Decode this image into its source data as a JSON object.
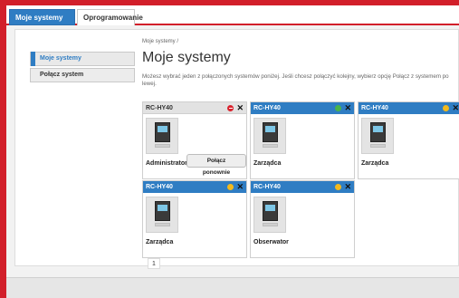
{
  "tabs": [
    {
      "label": "Moje systemy"
    },
    {
      "label": "Oprogramowanie"
    }
  ],
  "sidebar": {
    "items": [
      {
        "label": "Moje systemy"
      },
      {
        "label": "Połącz system"
      }
    ]
  },
  "main": {
    "breadcrumb": "Moje systemy /",
    "title": "Moje systemy",
    "description": "Możesz wybrać jeden z połączonych systemów poniżej. Jeśli chcesz połączyć kolejny, wybierz opcję Połącz z systemem po lewej."
  },
  "cards": [
    {
      "name": "RC-HY40",
      "status": "red",
      "role": "Administrator",
      "button": "Połącz ponownie"
    },
    {
      "name": "RC-HY40",
      "status": "green",
      "role": "Zarządca"
    },
    {
      "name": "RC-HY40",
      "status": "yellow",
      "role": "Zarządca"
    },
    {
      "name": "RC-HY40",
      "status": "yellow",
      "role": "Zarządca"
    },
    {
      "name": "RC-HY40",
      "status": "yellow",
      "role": "Obserwator"
    }
  ],
  "pagination": {
    "page": "1"
  },
  "colors": {
    "accent": "#2f7dc3",
    "frame": "#d21f2a"
  }
}
